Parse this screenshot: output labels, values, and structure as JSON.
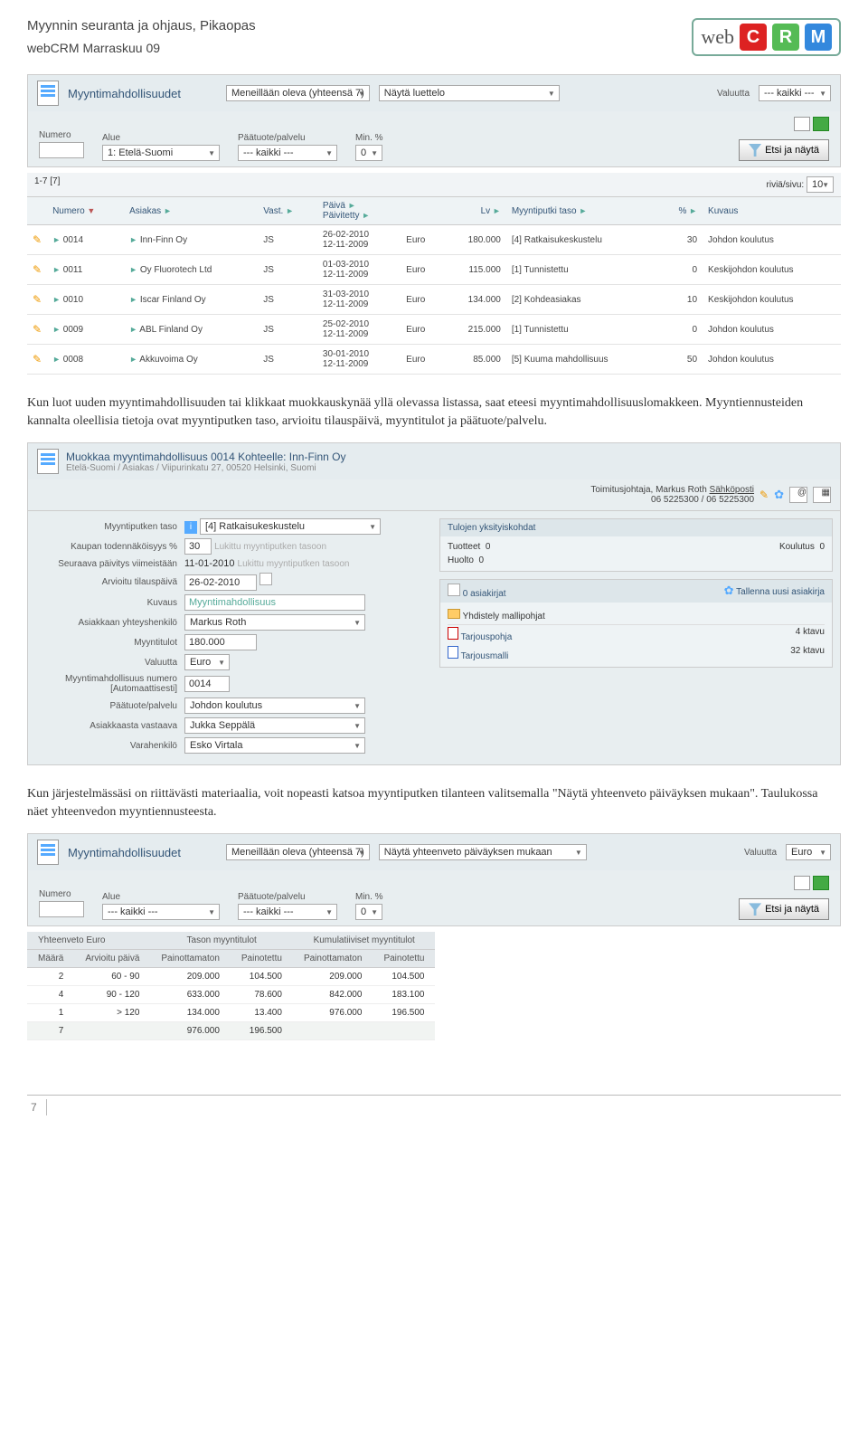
{
  "header": {
    "title": "Myynnin seuranta ja ohjaus, Pikaopas",
    "subtitle": "webCRM Marraskuu 09",
    "logo_web": "web",
    "logo_c": "C",
    "logo_r": "R",
    "logo_m": "M"
  },
  "panel1": {
    "title": "Myyntimahdollisuudet",
    "top_filters": {
      "status": "Meneillään oleva (yhteensä 7)",
      "view": "Näytä luettelo",
      "currency_lbl": "Valuutta",
      "currency": "--- kaikki ---"
    },
    "filters": {
      "numero_lbl": "Numero",
      "numero": "",
      "alue_lbl": "Alue",
      "alue": "1: Etelä-Suomi",
      "paatuote_lbl": "Päätuote/palvelu",
      "paatuote": "--- kaikki ---",
      "min_lbl": "Min. %",
      "min": "0",
      "search_btn": "Etsi ja näytä"
    },
    "count": "1-7  [7]",
    "rows_lbl": "riviä/sivu:",
    "rows_val": "10",
    "cols": {
      "numero": "Numero",
      "asiakas": "Asiakas",
      "vast": "Vast.",
      "paiva": "Päivä",
      "paivitetty": "Päivitetty",
      "lv": "Lv",
      "taso": "Myyntiputki taso",
      "pct": "%",
      "kuvaus": "Kuvaus"
    },
    "rows": [
      {
        "num": "0014",
        "asiakas": "Inn-Finn Oy",
        "vast": "JS",
        "d1": "26-02-2010",
        "d2": "12-11-2009",
        "cur": "Euro",
        "lv": "180.000",
        "taso": "[4] Ratkaisukeskustelu",
        "pct": "30",
        "kuv": "Johdon koulutus"
      },
      {
        "num": "0011",
        "asiakas": "Oy Fluorotech Ltd",
        "vast": "JS",
        "d1": "01-03-2010",
        "d2": "12-11-2009",
        "cur": "Euro",
        "lv": "115.000",
        "taso": "[1] Tunnistettu",
        "pct": "0",
        "kuv": "Keskijohdon koulutus"
      },
      {
        "num": "0010",
        "asiakas": "Iscar Finland Oy",
        "vast": "JS",
        "d1": "31-03-2010",
        "d2": "12-11-2009",
        "cur": "Euro",
        "lv": "134.000",
        "taso": "[2] Kohdeasiakas",
        "pct": "10",
        "kuv": "Keskijohdon koulutus"
      },
      {
        "num": "0009",
        "asiakas": "ABL Finland Oy",
        "vast": "JS",
        "d1": "25-02-2010",
        "d2": "12-11-2009",
        "cur": "Euro",
        "lv": "215.000",
        "taso": "[1] Tunnistettu",
        "pct": "0",
        "kuv": "Johdon koulutus"
      },
      {
        "num": "0008",
        "asiakas": "Akkuvoima Oy",
        "vast": "JS",
        "d1": "30-01-2010",
        "d2": "12-11-2009",
        "cur": "Euro",
        "lv": "85.000",
        "taso": "[5] Kuuma mahdollisuus",
        "pct": "50",
        "kuv": "Johdon koulutus"
      }
    ]
  },
  "para1": "Kun luot uuden myyntimahdollisuuden tai klikkaat muokkauskynää yllä olevassa listassa, saat eteesi myyntimahdollisuuslomakkeen. Myyntiennusteiden kannalta oleellisia tietoja ovat myyntiputken taso, arvioitu tilauspäivä, myyntitulot ja päätuote/palvelu.",
  "edit": {
    "title": "Muokkaa myyntimahdollisuus 0014 Kohteelle: Inn-Finn Oy",
    "sub": "Etelä-Suomi / Asiakas / Viipurinkatu 27, 00520 Helsinki, Suomi",
    "contact_line1": "Toimitusjohtaja, Markus Roth",
    "contact_email": "Sähköposti",
    "contact_line2": "06 5225300  /  06 5225300",
    "fields": {
      "taso_lbl": "Myyntiputken taso",
      "taso_val": "[4]  Ratkaisukeskustelu",
      "toden_lbl": "Kaupan todennäköisyys %",
      "toden_val": "30",
      "toden_lock": "Lukittu myyntiputken tasoon",
      "paiv_lbl": "Seuraava päivitys viimeistään",
      "paiv_val": "11-01-2010",
      "paiv_lock": "Lukittu myyntiputken tasoon",
      "arv_lbl": "Arvioitu tilauspäivä",
      "arv_val": "26-02-2010",
      "kuv_lbl": "Kuvaus",
      "kuv_val": "Myyntimahdollisuus",
      "yht_lbl": "Asiakkaan yhteyshenkilö",
      "yht_val": "Markus Roth",
      "tulot_lbl": "Myyntitulot",
      "tulot_val": "180.000",
      "val_lbl": "Valuutta",
      "val_val": "Euro",
      "num_lbl": "Myyntimahdollisuus numero [Automaattisesti]",
      "num_val": "0014",
      "paa_lbl": "Päätuote/palvelu",
      "paa_val": "Johdon koulutus",
      "vast_lbl": "Asiakkaasta vastaava",
      "vast_val": "Jukka Seppälä",
      "vara_lbl": "Varahenkilö",
      "vara_val": "Esko Virtala"
    },
    "right": {
      "tulo_head": "Tulojen yksityiskohdat",
      "tuotteet_lbl": "Tuotteet",
      "tuotteet_val": "0",
      "koulutus_lbl": "Koulutus",
      "koulutus_val": "0",
      "huolto_lbl": "Huolto",
      "huolto_val": "0",
      "docs_head": "0 asiakirjat",
      "docs_new": "Tallenna uusi asiakirja",
      "templ_head": "Yhdistely mallipohjat",
      "t1": "Tarjouspohja",
      "t1s": "4 ktavu",
      "t2": "Tarjousmalli",
      "t2s": "32 ktavu"
    }
  },
  "para2": "Kun järjestelmässäsi on riittävästi materiaalia, voit nopeasti katsoa myyntiputken tilanteen valitsemalla \"Näytä yhteenveto päiväyksen mukaan\". Taulukossa näet yhteenvedon myyntiennusteesta.",
  "panel2": {
    "title": "Myyntimahdollisuudet",
    "top_filters": {
      "status": "Meneillään oleva (yhteensä 7)",
      "view": "Näytä yhteenveto päiväyksen mukaan",
      "currency_lbl": "Valuutta",
      "currency": "Euro"
    },
    "filters": {
      "numero_lbl": "Numero",
      "alue_lbl": "Alue",
      "alue": "--- kaikki ---",
      "paatuote_lbl": "Päätuote/palvelu",
      "paatuote": "--- kaikki ---",
      "min_lbl": "Min. %",
      "min": "0",
      "search_btn": "Etsi ja näytä"
    }
  },
  "summary": {
    "h1": "Yhteenveto  Euro",
    "h2": "Tason myyntitulot",
    "h3": "Kumulatiiviset myyntitulot",
    "c1": "Määrä",
    "c2": "Arvioitu päivä",
    "c3": "Painottamaton",
    "c4": "Painotettu",
    "c5": "Painottamaton",
    "c6": "Painotettu",
    "rows": [
      {
        "m": "2",
        "d": "60 - 90",
        "a": "209.000",
        "b": "104.500",
        "c": "209.000",
        "e": "104.500"
      },
      {
        "m": "4",
        "d": "90 - 120",
        "a": "633.000",
        "b": "78.600",
        "c": "842.000",
        "e": "183.100"
      },
      {
        "m": "1",
        "d": "> 120",
        "a": "134.000",
        "b": "13.400",
        "c": "976.000",
        "e": "196.500"
      }
    ],
    "total": {
      "m": "7",
      "a": "976.000",
      "b": "196.500"
    }
  },
  "page_num": "7"
}
